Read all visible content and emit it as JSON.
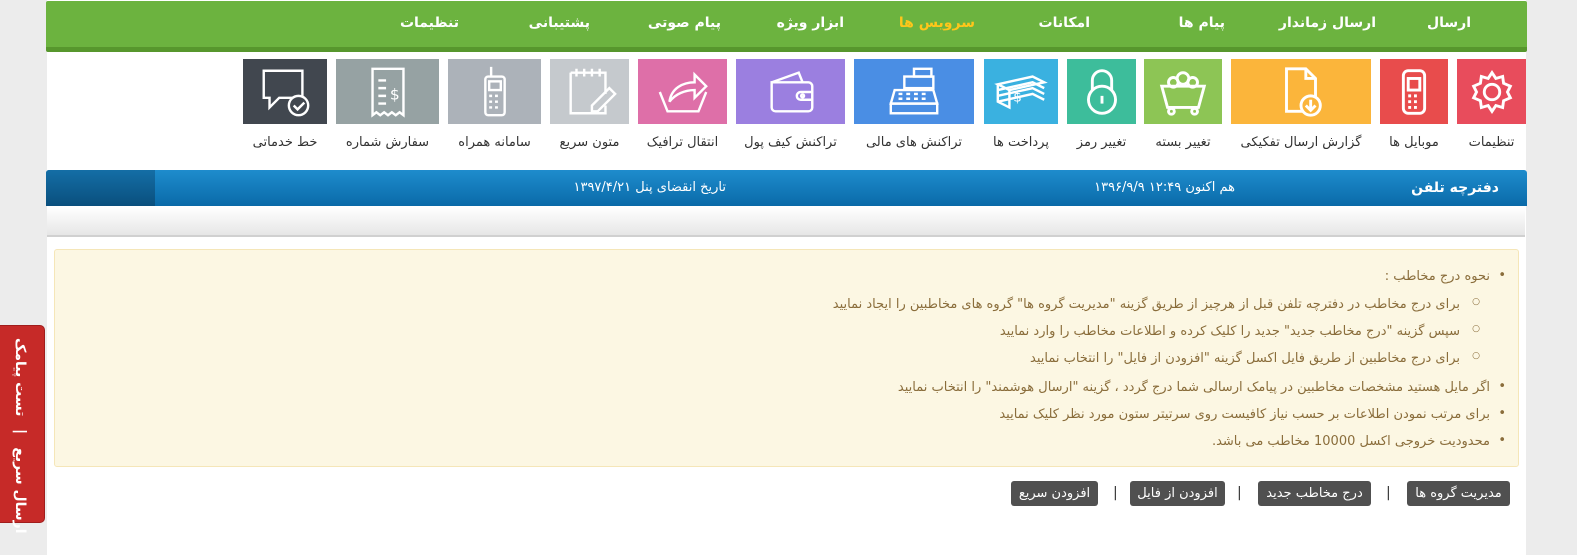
{
  "nav": {
    "items": [
      {
        "label": "ارسال"
      },
      {
        "label": "ارسال زماندار"
      },
      {
        "label": "پیام ها"
      },
      {
        "label": "امکانات"
      },
      {
        "label": "سرویس ها"
      },
      {
        "label": "ابزار ویژه"
      },
      {
        "label": "پیام صوتی"
      },
      {
        "label": "پشتیبانی"
      },
      {
        "label": "تنظیمات"
      }
    ],
    "active": "سرویس ها"
  },
  "tiles": [
    {
      "label": "تنظیمات",
      "icon": "gear-icon",
      "color": "#e84c5c"
    },
    {
      "label": "موبایل ها",
      "icon": "mobile-icon",
      "color": "#e84c4c"
    },
    {
      "label": "گزارش ارسال تفکیکی",
      "icon": "file-download-icon",
      "color": "#fbb53b"
    },
    {
      "label": "تغییر بسته",
      "icon": "cart-icon",
      "color": "#8dc555"
    },
    {
      "label": "تغییر رمز",
      "icon": "lock-icon",
      "color": "#3dbd9b"
    },
    {
      "label": "پرداخت ها",
      "icon": "money-icon",
      "color": "#3ab1e0"
    },
    {
      "label": "تراکنش های مالی",
      "icon": "cash-register-icon",
      "color": "#4a8ee4"
    },
    {
      "label": "تراکنش کیف پول",
      "icon": "wallet-icon",
      "color": "#9b7fe0"
    },
    {
      "label": "انتقال ترافیک",
      "icon": "transfer-icon",
      "color": "#de6fa8"
    },
    {
      "label": "متون سریع",
      "icon": "note-edit-icon",
      "color": "#c5c9cd"
    },
    {
      "label": "سامانه همراه",
      "icon": "phone-icon",
      "color": "#acb2b9"
    },
    {
      "label": "سفارش شماره",
      "icon": "receipt-icon",
      "color": "#96a2a3"
    },
    {
      "label": "خط خدماتی",
      "icon": "chat-check-icon",
      "color": "#41474f"
    }
  ],
  "header": {
    "title": "دفترچه تلفن",
    "now": "هم اکنون ۱۲:۴۹ ۱۳۹۶/۹/۹",
    "expiry": "تاریخ انقضای پنل ۱۳۹۷/۴/۲۱"
  },
  "info": {
    "heading": "نحوه درج مخاطب :",
    "steps": [
      "برای درج مخاطب در دفترچه تلفن قبل از هرچیز از طریق گزینه \"مدیریت گروه ها\" گروه های مخاطبین را ایجاد نمایید",
      "سپس گزینه \"درج مخاطب جدید\" جدید را کلیک کرده و اطلاعات مخاطب را وارد نمایید",
      "برای درج مخاطبین از طریق فایل اکسل گزینه \"افزودن از فایل\" را انتخاب نمایید"
    ],
    "notes": [
      "اگر مایل هستید مشخصات مخاطبین در پیامک ارسالی شما درج گردد ، گزینه \"ارسال هوشمند\" را انتخاب نمایید",
      "برای مرتب نمودن اطلاعات بر حسب نیاز کافیست روی سرتیتر ستون مورد نظر کلیک نمایید",
      "محدودیت خروجی اکسل 10000 مخاطب می باشد."
    ]
  },
  "buttons": {
    "groups": "مدیریت گروه ها",
    "new_contact": "درج مخاطب جدید",
    "from_file": "افزودن از فایل",
    "quick_add": "افزودن سریع",
    "separator": "|"
  },
  "sidetab": {
    "quick_send": "ارسال سریع",
    "separator": "|",
    "test_sms": "تست پیامک"
  }
}
